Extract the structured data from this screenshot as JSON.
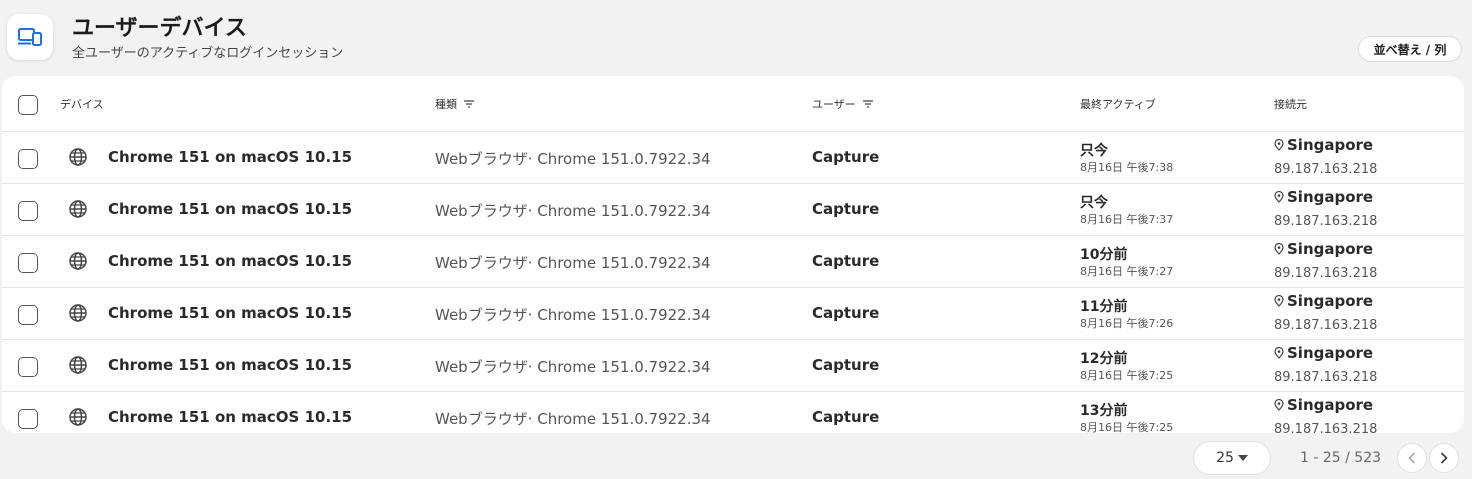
{
  "header": {
    "icon": "devices-icon",
    "title": "ユーザーデバイス",
    "subtitle": "全ユーザーのアクティブなログインセッション",
    "sort_label": "並べ替え / 列"
  },
  "colors": {
    "accent": "#1a73e8",
    "border": "#e4e4e4",
    "background": "#f2f2f3"
  },
  "table": {
    "columns": {
      "device": "デバイス",
      "type": "種類",
      "user": "ユーザー",
      "last_active": "最終アクティブ",
      "source": "接続元"
    },
    "rows": [
      {
        "device": "Chrome 151 on macOS 10.15",
        "type": "Webブラウザ· Chrome 151.0.7922.34",
        "user": "Capture",
        "relative": "只今",
        "absolute": "8月16日 午後7:38",
        "location": "Singapore",
        "ip": "89.187.163.218"
      },
      {
        "device": "Chrome 151 on macOS 10.15",
        "type": "Webブラウザ· Chrome 151.0.7922.34",
        "user": "Capture",
        "relative": "只今",
        "absolute": "8月16日 午後7:37",
        "location": "Singapore",
        "ip": "89.187.163.218"
      },
      {
        "device": "Chrome 151 on macOS 10.15",
        "type": "Webブラウザ· Chrome 151.0.7922.34",
        "user": "Capture",
        "relative": "10分前",
        "absolute": "8月16日 午後7:27",
        "location": "Singapore",
        "ip": "89.187.163.218"
      },
      {
        "device": "Chrome 151 on macOS 10.15",
        "type": "Webブラウザ· Chrome 151.0.7922.34",
        "user": "Capture",
        "relative": "11分前",
        "absolute": "8月16日 午後7:26",
        "location": "Singapore",
        "ip": "89.187.163.218"
      },
      {
        "device": "Chrome 151 on macOS 10.15",
        "type": "Webブラウザ· Chrome 151.0.7922.34",
        "user": "Capture",
        "relative": "12分前",
        "absolute": "8月16日 午後7:25",
        "location": "Singapore",
        "ip": "89.187.163.218"
      },
      {
        "device": "Chrome 151 on macOS 10.15",
        "type": "Webブラウザ· Chrome 151.0.7922.34",
        "user": "Capture",
        "relative": "13分前",
        "absolute": "8月16日 午後7:25",
        "location": "Singapore",
        "ip": "89.187.163.218"
      }
    ]
  },
  "pagination": {
    "page_size": "25",
    "range": "1 - 25 / 523"
  }
}
